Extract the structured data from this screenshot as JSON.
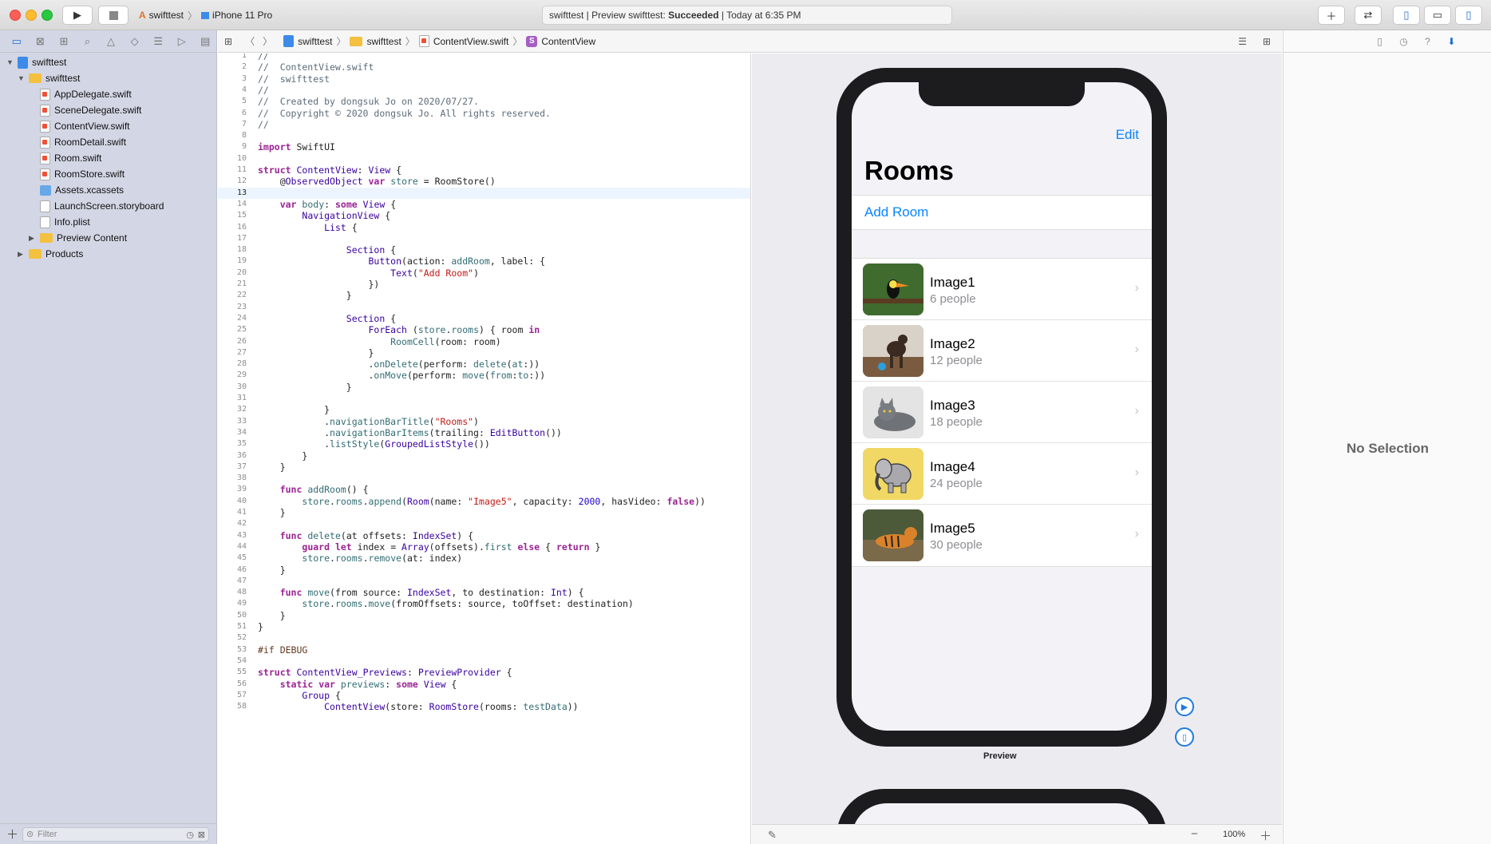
{
  "toolbar": {
    "scheme_target": "swifttest",
    "scheme_device": "iPhone 11 Pro",
    "status_prefix": "swifttest | Preview swifttest: ",
    "status_result": "Succeeded",
    "status_suffix": " | Today at 6:35 PM"
  },
  "navigator": {
    "items": [
      {
        "label": "swifttest",
        "kind": "project",
        "indent": 0,
        "open": true
      },
      {
        "label": "swifttest",
        "kind": "folder",
        "indent": 1,
        "open": true
      },
      {
        "label": "AppDelegate.swift",
        "kind": "swift",
        "indent": 2
      },
      {
        "label": "SceneDelegate.swift",
        "kind": "swift",
        "indent": 2
      },
      {
        "label": "ContentView.swift",
        "kind": "swift",
        "indent": 2
      },
      {
        "label": "RoomDetail.swift",
        "kind": "swift",
        "indent": 2
      },
      {
        "label": "Room.swift",
        "kind": "swift",
        "indent": 2
      },
      {
        "label": "RoomStore.swift",
        "kind": "swift",
        "indent": 2
      },
      {
        "label": "Assets.xcassets",
        "kind": "assets",
        "indent": 2
      },
      {
        "label": "LaunchScreen.storyboard",
        "kind": "file",
        "indent": 2
      },
      {
        "label": "Info.plist",
        "kind": "file",
        "indent": 2
      },
      {
        "label": "Preview Content",
        "kind": "folder",
        "indent": 2,
        "open": false
      },
      {
        "label": "Products",
        "kind": "folder",
        "indent": 1,
        "open": false
      }
    ],
    "filter_placeholder": "Filter"
  },
  "jumpbar": {
    "crumbs": [
      "swifttest",
      "swifttest",
      "ContentView.swift",
      "ContentView"
    ]
  },
  "editor": {
    "highlight_line": 13,
    "lines": [
      {
        "n": 1,
        "h": "<span class=\"cm\">//</span>"
      },
      {
        "n": 2,
        "h": "<span class=\"cm\">//  ContentView.swift</span>"
      },
      {
        "n": 3,
        "h": "<span class=\"cm\">//  swifttest</span>"
      },
      {
        "n": 4,
        "h": "<span class=\"cm\">//</span>"
      },
      {
        "n": 5,
        "h": "<span class=\"cm\">//  Created by dongsuk Jo on 2020/07/27.</span>"
      },
      {
        "n": 6,
        "h": "<span class=\"cm\">//  Copyright © 2020 dongsuk Jo. All rights reserved.</span>"
      },
      {
        "n": 7,
        "h": "<span class=\"cm\">//</span>"
      },
      {
        "n": 8,
        "h": ""
      },
      {
        "n": 9,
        "h": "<span class=\"kw\">import</span> SwiftUI"
      },
      {
        "n": 10,
        "h": ""
      },
      {
        "n": 11,
        "h": "<span class=\"kw\">struct</span> <span class=\"ty\">ContentView</span>: <span class=\"ty\">View</span> {"
      },
      {
        "n": 12,
        "h": "    @<span class=\"ty\">ObservedObject</span> <span class=\"kw\">var</span> <span class=\"fn\">store</span> = RoomStore()"
      },
      {
        "n": 13,
        "h": ""
      },
      {
        "n": 14,
        "h": "    <span class=\"kw\">var</span> <span class=\"fn\">body</span>: <span class=\"kw\">some</span> <span class=\"ty\">View</span> {"
      },
      {
        "n": 15,
        "h": "        <span class=\"ty\">NavigationView</span> {"
      },
      {
        "n": 16,
        "h": "            <span class=\"ty\">List</span> {"
      },
      {
        "n": 17,
        "h": ""
      },
      {
        "n": 18,
        "h": "                <span class=\"ty\">Section</span> {"
      },
      {
        "n": 19,
        "h": "                    <span class=\"ty\">Button</span>(action: <span class=\"fn\">addRoom</span>, label: {"
      },
      {
        "n": 20,
        "h": "                        <span class=\"ty\">Text</span>(<span class=\"st\">\"Add Room\"</span>)"
      },
      {
        "n": 21,
        "h": "                    })"
      },
      {
        "n": 22,
        "h": "                }"
      },
      {
        "n": 23,
        "h": ""
      },
      {
        "n": 24,
        "h": "                <span class=\"ty\">Section</span> {"
      },
      {
        "n": 25,
        "h": "                    <span class=\"ty\">ForEach</span> (<span class=\"fn\">store</span>.<span class=\"fn\">rooms</span>) { room <span class=\"kw\">in</span>"
      },
      {
        "n": 26,
        "h": "                        <span class=\"fn\">RoomCell</span>(room: room)"
      },
      {
        "n": 27,
        "h": "                    }"
      },
      {
        "n": 28,
        "h": "                    .<span class=\"fn\">onDelete</span>(perform: <span class=\"fn\">delete</span>(<span class=\"fn\">at</span>:))"
      },
      {
        "n": 29,
        "h": "                    .<span class=\"fn\">onMove</span>(perform: <span class=\"fn\">move</span>(<span class=\"fn\">from</span>:<span class=\"fn\">to</span>:))"
      },
      {
        "n": 30,
        "h": "                }"
      },
      {
        "n": 31,
        "h": ""
      },
      {
        "n": 32,
        "h": "            }"
      },
      {
        "n": 33,
        "h": "            .<span class=\"fn\">navigationBarTitle</span>(<span class=\"st\">\"Rooms\"</span>)"
      },
      {
        "n": 34,
        "h": "            .<span class=\"fn\">navigationBarItems</span>(trailing: <span class=\"ty\">EditButton</span>())"
      },
      {
        "n": 35,
        "h": "            .<span class=\"fn\">listStyle</span>(<span class=\"ty\">GroupedListStyle</span>())"
      },
      {
        "n": 36,
        "h": "        }"
      },
      {
        "n": 37,
        "h": "    }"
      },
      {
        "n": 38,
        "h": ""
      },
      {
        "n": 39,
        "h": "    <span class=\"kw\">func</span> <span class=\"fn\">addRoom</span>() {"
      },
      {
        "n": 40,
        "h": "        <span class=\"fn\">store</span>.<span class=\"fn\">rooms</span>.<span class=\"fn\">append</span>(<span class=\"ty\">Room</span>(name: <span class=\"st\">\"Image5\"</span>, capacity: <span class=\"nm\">2000</span>, hasVideo: <span class=\"kw\">false</span>))"
      },
      {
        "n": 41,
        "h": "    }"
      },
      {
        "n": 42,
        "h": ""
      },
      {
        "n": 43,
        "h": "    <span class=\"kw\">func</span> <span class=\"fn\">delete</span>(at offsets: <span class=\"ty\">IndexSet</span>) {"
      },
      {
        "n": 44,
        "h": "        <span class=\"kw\">guard</span> <span class=\"kw\">let</span> index = <span class=\"ty\">Array</span>(offsets).<span class=\"fn\">first</span> <span class=\"kw\">else</span> { <span class=\"kw\">return</span> }"
      },
      {
        "n": 45,
        "h": "        <span class=\"fn\">store</span>.<span class=\"fn\">rooms</span>.<span class=\"fn\">remove</span>(at: index)"
      },
      {
        "n": 46,
        "h": "    }"
      },
      {
        "n": 47,
        "h": ""
      },
      {
        "n": 48,
        "h": "    <span class=\"kw\">func</span> <span class=\"fn\">move</span>(from source: <span class=\"ty\">IndexSet</span>, to destination: <span class=\"ty\">Int</span>) {"
      },
      {
        "n": 49,
        "h": "        <span class=\"fn\">store</span>.<span class=\"fn\">rooms</span>.<span class=\"fn\">move</span>(fromOffsets: source, toOffset: destination)"
      },
      {
        "n": 50,
        "h": "    }"
      },
      {
        "n": 51,
        "h": "}"
      },
      {
        "n": 52,
        "h": ""
      },
      {
        "n": 53,
        "h": "<span class=\"pp\">#if DEBUG</span>"
      },
      {
        "n": 54,
        "h": ""
      },
      {
        "n": 55,
        "h": "<span class=\"kw\">struct</span> <span class=\"ty\">ContentView_Previews</span>: <span class=\"ty\">PreviewProvider</span> {"
      },
      {
        "n": 56,
        "h": "    <span class=\"kw\">static</span> <span class=\"kw\">var</span> <span class=\"fn\">previews</span>: <span class=\"kw\">some</span> <span class=\"ty\">View</span> {"
      },
      {
        "n": 57,
        "h": "        <span class=\"ty\">Group</span> {"
      },
      {
        "n": 58,
        "h": "            <span class=\"ty\">ContentView</span>(store: <span class=\"ty\">RoomStore</span>(rooms: <span class=\"fn\">testData</span>))"
      }
    ]
  },
  "preview": {
    "edit_label": "Edit",
    "nav_title": "Rooms",
    "add_room_label": "Add Room",
    "rooms": [
      {
        "name": "Image1",
        "people": "6 people",
        "thumb": "toucan",
        "bg": "#3f6b2e"
      },
      {
        "name": "Image2",
        "people": "12 people",
        "thumb": "dog",
        "bg": "#6d5a4a"
      },
      {
        "name": "Image3",
        "people": "18 people",
        "thumb": "cat",
        "bg": "#c8c8c8"
      },
      {
        "name": "Image4",
        "people": "24 people",
        "thumb": "elephant",
        "bg": "#f1d764"
      },
      {
        "name": "Image5",
        "people": "30 people",
        "thumb": "tiger",
        "bg": "#5a4a2e"
      }
    ],
    "label": "Preview",
    "zoom": "100%"
  },
  "inspector": {
    "empty_text": "No Selection"
  }
}
